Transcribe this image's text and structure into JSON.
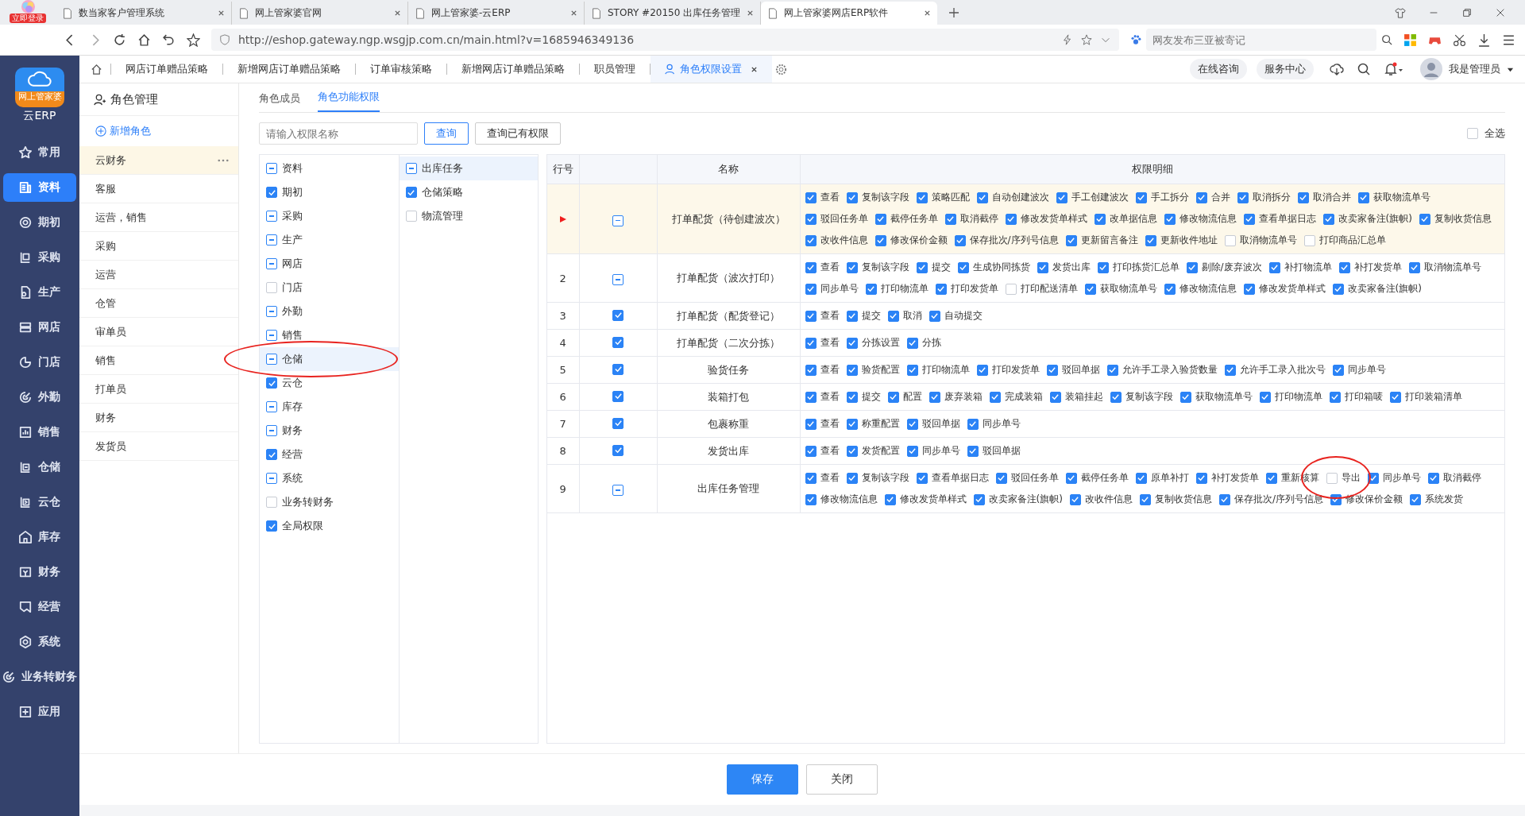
{
  "browser": {
    "login_badge": "立即登录",
    "tabs": [
      {
        "title": "数当家客户管理系统",
        "selected": false
      },
      {
        "title": "网上管家婆官网",
        "selected": false
      },
      {
        "title": "网上管家婆-云ERP",
        "selected": false
      },
      {
        "title": "STORY #20150 出库任务管理",
        "selected": false
      },
      {
        "title": "网上管家婆网店ERP软件",
        "selected": true
      }
    ],
    "url": "http://eshop.gateway.ngp.wsgjp.com.cn/main.html?v=1685946349136",
    "search_placeholder": "网友发布三亚被寄记"
  },
  "app": {
    "logo_badge": "网上管家婆",
    "logo_text": "云ERP"
  },
  "nav": [
    {
      "label": "常用",
      "selected": false
    },
    {
      "label": "资料",
      "selected": true
    },
    {
      "label": "期初",
      "selected": false
    },
    {
      "label": "采购",
      "selected": false
    },
    {
      "label": "生产",
      "selected": false
    },
    {
      "label": "网店",
      "selected": false
    },
    {
      "label": "门店",
      "selected": false
    },
    {
      "label": "外勤",
      "selected": false
    },
    {
      "label": "销售",
      "selected": false
    },
    {
      "label": "仓储",
      "selected": false
    },
    {
      "label": "云仓",
      "selected": false
    },
    {
      "label": "库存",
      "selected": false
    },
    {
      "label": "财务",
      "selected": false
    },
    {
      "label": "经营",
      "selected": false
    },
    {
      "label": "系统",
      "selected": false
    },
    {
      "label": "业务转财务",
      "selected": false
    },
    {
      "label": "应用",
      "selected": false
    }
  ],
  "top_tabs": [
    {
      "label": "网店订单赠品策略",
      "selected": false
    },
    {
      "label": "新增网店订单赠品策略",
      "selected": false
    },
    {
      "label": "订单审核策略",
      "selected": false
    },
    {
      "label": "新增网店订单赠品策略",
      "selected": false
    },
    {
      "label": "职员管理",
      "selected": false
    },
    {
      "label": "角色权限设置",
      "selected": true
    }
  ],
  "top_links": [
    "在线咨询",
    "服务中心"
  ],
  "user": "我是管理员",
  "roles": {
    "title": "角色管理",
    "add": "新增角色",
    "items": [
      {
        "label": "云财务",
        "selected": true
      },
      {
        "label": "客服",
        "selected": false
      },
      {
        "label": "运营，销售",
        "selected": false
      },
      {
        "label": "采购",
        "selected": false
      },
      {
        "label": "运营",
        "selected": false
      },
      {
        "label": "仓管",
        "selected": false
      },
      {
        "label": "审单员",
        "selected": false
      },
      {
        "label": "销售",
        "selected": false
      },
      {
        "label": "打单员",
        "selected": false
      },
      {
        "label": "财务",
        "selected": false
      },
      {
        "label": "发货员",
        "selected": false
      }
    ]
  },
  "subtabs": [
    {
      "label": "角色成员",
      "selected": false
    },
    {
      "label": "角色功能权限",
      "selected": true
    }
  ],
  "search": {
    "placeholder": "请输入权限名称",
    "buttons": [
      {
        "label": "查询",
        "kind": "primary"
      },
      {
        "label": "查询已有权限",
        "kind": "default"
      }
    ]
  },
  "select_all": {
    "label": "全选",
    "checked": false
  },
  "modules": [
    {
      "label": "资料",
      "partial": true,
      "selected": false,
      "circled": false
    },
    {
      "label": "期初",
      "checked": true,
      "selected": false,
      "circled": false
    },
    {
      "label": "采购",
      "partial": true,
      "selected": false,
      "circled": false
    },
    {
      "label": "生产",
      "partial": true,
      "selected": false,
      "circled": false
    },
    {
      "label": "网店",
      "partial": true,
      "selected": false,
      "circled": false
    },
    {
      "label": "门店",
      "checked": false,
      "selected": false,
      "circled": false
    },
    {
      "label": "外勤",
      "partial": true,
      "selected": false,
      "circled": false
    },
    {
      "label": "销售",
      "partial": true,
      "selected": false,
      "circled": false
    },
    {
      "label": "仓储",
      "partial": true,
      "selected": true,
      "circled": true
    },
    {
      "label": "云仓",
      "checked": true,
      "selected": false,
      "circled": false
    },
    {
      "label": "库存",
      "partial": true,
      "selected": false,
      "circled": false
    },
    {
      "label": "财务",
      "partial": true,
      "selected": false,
      "circled": false
    },
    {
      "label": "经营",
      "checked": true,
      "selected": false,
      "circled": false
    },
    {
      "label": "系统",
      "partial": true,
      "selected": false,
      "circled": false
    },
    {
      "label": "业务转财务",
      "checked": false,
      "selected": false,
      "circled": false
    },
    {
      "label": "全局权限",
      "checked": true,
      "selected": false,
      "circled": false
    }
  ],
  "submodules": [
    {
      "label": "出库任务",
      "partial": true,
      "selected": true
    },
    {
      "label": "仓储策略",
      "checked": true,
      "selected": false
    },
    {
      "label": "物流管理",
      "checked": false,
      "selected": false
    }
  ],
  "table": {
    "columns": [
      "行号",
      "名称",
      "权限明细"
    ],
    "rows": [
      {
        "current": true,
        "partial": true,
        "name": "打单配货（待创建波次）",
        "items": [
          {
            "label": "查看",
            "checked": true
          },
          {
            "label": "复制该字段",
            "checked": true
          },
          {
            "label": "策略匹配",
            "checked": true
          },
          {
            "label": "自动创建波次",
            "checked": true
          },
          {
            "label": "手工创建波次",
            "checked": true
          },
          {
            "label": "手工拆分",
            "checked": true
          },
          {
            "label": "合并",
            "checked": true
          },
          {
            "label": "取消拆分",
            "checked": true
          },
          {
            "label": "取消合并",
            "checked": true
          },
          {
            "label": "获取物流单号",
            "checked": true
          },
          {
            "label": "驳回任务单",
            "checked": true
          },
          {
            "label": "截停任务单",
            "checked": true
          },
          {
            "label": "取消截停",
            "checked": true
          },
          {
            "label": "修改发货单样式",
            "checked": true
          },
          {
            "label": "改单据信息",
            "checked": true
          },
          {
            "label": "修改物流信息",
            "checked": true
          },
          {
            "label": "查看单据日志",
            "checked": true
          },
          {
            "label": "改卖家备注(旗帜)",
            "checked": true
          },
          {
            "label": "复制收货信息",
            "checked": true
          },
          {
            "label": "改收件信息",
            "checked": true
          },
          {
            "label": "修改保价金额",
            "checked": true
          },
          {
            "label": "保存批次/序列号信息",
            "checked": true
          },
          {
            "label": "更新留言备注",
            "checked": true
          },
          {
            "label": "更新收件地址",
            "checked": true
          },
          {
            "label": "取消物流单号",
            "checked": false
          },
          {
            "label": "打印商品汇总单",
            "checked": false
          }
        ]
      },
      {
        "no": "2",
        "partial": true,
        "name": "打单配货（波次打印）",
        "items": [
          {
            "label": "查看",
            "checked": true
          },
          {
            "label": "复制该字段",
            "checked": true
          },
          {
            "label": "提交",
            "checked": true
          },
          {
            "label": "生成协同拣货",
            "checked": true
          },
          {
            "label": "发货出库",
            "checked": true
          },
          {
            "label": "打印拣货汇总单",
            "checked": true
          },
          {
            "label": "剔除/废弃波次",
            "checked": true
          },
          {
            "label": "补打物流单",
            "checked": true
          },
          {
            "label": "补打发货单",
            "checked": true
          },
          {
            "label": "取消物流单号",
            "checked": true
          },
          {
            "label": "同步单号",
            "checked": true
          },
          {
            "label": "打印物流单",
            "checked": true
          },
          {
            "label": "打印发货单",
            "checked": true
          },
          {
            "label": "打印配送清单",
            "checked": false
          },
          {
            "label": "获取物流单号",
            "checked": true
          },
          {
            "label": "修改物流信息",
            "checked": true
          },
          {
            "label": "修改发货单样式",
            "checked": true
          },
          {
            "label": "改卖家备注(旗帜)",
            "checked": true
          }
        ]
      },
      {
        "no": "3",
        "checked": true,
        "name": "打单配货（配货登记）",
        "items": [
          {
            "label": "查看",
            "checked": true
          },
          {
            "label": "提交",
            "checked": true
          },
          {
            "label": "取消",
            "checked": true
          },
          {
            "label": "自动提交",
            "checked": true
          }
        ]
      },
      {
        "no": "4",
        "checked": true,
        "name": "打单配货（二次分拣）",
        "items": [
          {
            "label": "查看",
            "checked": true
          },
          {
            "label": "分拣设置",
            "checked": true
          },
          {
            "label": "分拣",
            "checked": true
          }
        ]
      },
      {
        "no": "5",
        "checked": true,
        "name": "验货任务",
        "items": [
          {
            "label": "查看",
            "checked": true
          },
          {
            "label": "验货配置",
            "checked": true
          },
          {
            "label": "打印物流单",
            "checked": true
          },
          {
            "label": "打印发货单",
            "checked": true
          },
          {
            "label": "驳回单据",
            "checked": true
          },
          {
            "label": "允许手工录入验货数量",
            "checked": true
          },
          {
            "label": "允许手工录入批次号",
            "checked": true
          },
          {
            "label": "同步单号",
            "checked": true
          }
        ]
      },
      {
        "no": "6",
        "checked": true,
        "name": "装箱打包",
        "items": [
          {
            "label": "查看",
            "checked": true
          },
          {
            "label": "提交",
            "checked": true
          },
          {
            "label": "配置",
            "checked": true
          },
          {
            "label": "废弃装箱",
            "checked": true
          },
          {
            "label": "完成装箱",
            "checked": true
          },
          {
            "label": "装箱挂起",
            "checked": true
          },
          {
            "label": "复制该字段",
            "checked": true
          },
          {
            "label": "获取物流单号",
            "checked": true
          },
          {
            "label": "打印物流单",
            "checked": true
          },
          {
            "label": "打印箱唛",
            "checked": true
          },
          {
            "label": "打印装箱清单",
            "checked": true
          }
        ]
      },
      {
        "no": "7",
        "checked": true,
        "name": "包裹称重",
        "items": [
          {
            "label": "查看",
            "checked": true
          },
          {
            "label": "称重配置",
            "checked": true
          },
          {
            "label": "驳回单据",
            "checked": true
          },
          {
            "label": "同步单号",
            "checked": true
          }
        ]
      },
      {
        "no": "8",
        "checked": true,
        "name": "发货出库",
        "items": [
          {
            "label": "查看",
            "checked": true
          },
          {
            "label": "发货配置",
            "checked": true
          },
          {
            "label": "同步单号",
            "checked": true
          },
          {
            "label": "驳回单据",
            "checked": true
          }
        ]
      },
      {
        "no": "9",
        "partial": true,
        "name": "出库任务管理",
        "items": [
          {
            "label": "查看",
            "checked": true
          },
          {
            "label": "复制该字段",
            "checked": true
          },
          {
            "label": "查看单据日志",
            "checked": true
          },
          {
            "label": "驳回任务单",
            "checked": true
          },
          {
            "label": "截停任务单",
            "checked": true
          },
          {
            "label": "原单补打",
            "checked": true
          },
          {
            "label": "补打发货单",
            "checked": true
          },
          {
            "label": "重新核算",
            "checked": true
          },
          {
            "label": "导出",
            "checked": false,
            "circled": true
          },
          {
            "label": "同步单号",
            "checked": true
          },
          {
            "label": "取消截停",
            "checked": true
          },
          {
            "label": "修改物流信息",
            "checked": true
          },
          {
            "label": "修改发货单样式",
            "checked": true
          },
          {
            "label": "改卖家备注(旗帜)",
            "checked": true
          },
          {
            "label": "改收件信息",
            "checked": true
          },
          {
            "label": "复制收货信息",
            "checked": true
          },
          {
            "label": "保存批次/序列号信息",
            "checked": true
          },
          {
            "label": "修改保价金额",
            "checked": true
          },
          {
            "label": "系统发货",
            "checked": true
          }
        ]
      }
    ]
  },
  "footer": {
    "buttons": [
      {
        "label": "保存",
        "kind": "primary"
      },
      {
        "label": "关闭",
        "kind": "default"
      }
    ]
  }
}
